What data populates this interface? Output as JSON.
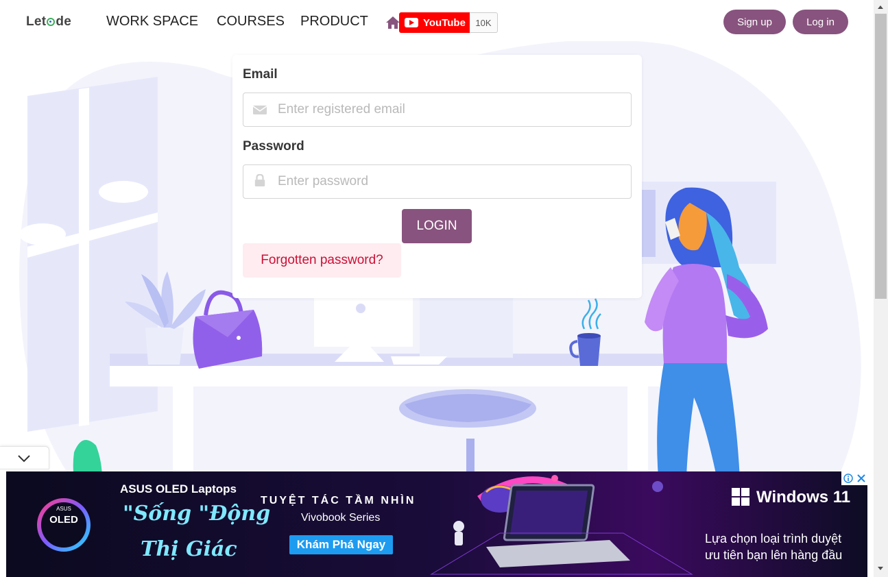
{
  "nav": {
    "logo_text_left": "Let",
    "logo_text_right": "de",
    "links": [
      "WORK SPACE",
      "COURSES",
      "PRODUCT"
    ],
    "youtube_label": "YouTube",
    "youtube_count": "10K",
    "signup_label": "Sign up",
    "login_label": "Log in"
  },
  "form": {
    "email_label": "Email",
    "email_placeholder": "Enter registered email",
    "email_value": "",
    "password_label": "Password",
    "password_placeholder": "Enter password",
    "password_value": "",
    "login_button": "LOGIN",
    "forgot_button": "Forgotten password?"
  },
  "ad": {
    "brand_badge": "OLED",
    "brand_small": "ASUS",
    "headline": "ASUS OLED Laptops",
    "slogan_line1": "\"Sống \"Động",
    "slogan_line2": "Thị Giác",
    "tagline": "TUYỆT TÁC TẦM NHÌN",
    "series": "Vivobook Series",
    "cta": "Khám Phá Ngay",
    "windows": "Windows 11",
    "subtext_line1": "Lựa chọn loại trình duyệt",
    "subtext_line2": "ưu tiên bạn lên hàng đầu"
  },
  "colors": {
    "brand_purple": "#88537e",
    "youtube_red": "#ff0000",
    "forgot_bg": "#feecf0",
    "forgot_text": "#cc0f35"
  },
  "icons": {
    "home": "home-icon",
    "email": "envelope-icon",
    "password": "lock-icon",
    "collapse": "chevron-down-icon"
  }
}
